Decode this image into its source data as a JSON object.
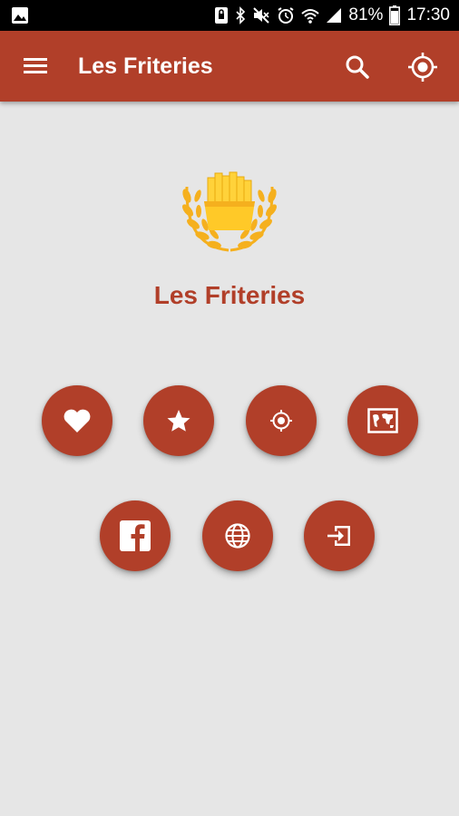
{
  "status_bar": {
    "battery_percent": "81%",
    "time": "17:30",
    "icons": [
      "image-notification-icon",
      "lock-notification-icon",
      "bluetooth-icon",
      "mute-icon",
      "alarm-icon",
      "wifi-icon",
      "signal-icon",
      "battery-icon"
    ]
  },
  "app_bar": {
    "title": "Les Friteries",
    "menu_icon": "menu-icon",
    "search_icon": "search-icon",
    "locate_icon": "gps-locate-icon"
  },
  "main": {
    "logo": "fries-laurel-logo",
    "app_name": "Les Friteries",
    "buttons_row1": [
      {
        "name": "favorites-button",
        "icon": "heart-icon"
      },
      {
        "name": "top-rated-button",
        "icon": "star-icon"
      },
      {
        "name": "nearby-button",
        "icon": "gps-icon"
      },
      {
        "name": "map-button",
        "icon": "world-map-icon"
      }
    ],
    "buttons_row2": [
      {
        "name": "facebook-button",
        "icon": "facebook-icon"
      },
      {
        "name": "website-button",
        "icon": "globe-icon"
      },
      {
        "name": "login-button",
        "icon": "login-icon"
      }
    ]
  },
  "colors": {
    "primary": "#b13f29",
    "background": "#e6e6e6",
    "logo_gold": "#f5b01e",
    "fries_yellow": "#ffd23a"
  }
}
